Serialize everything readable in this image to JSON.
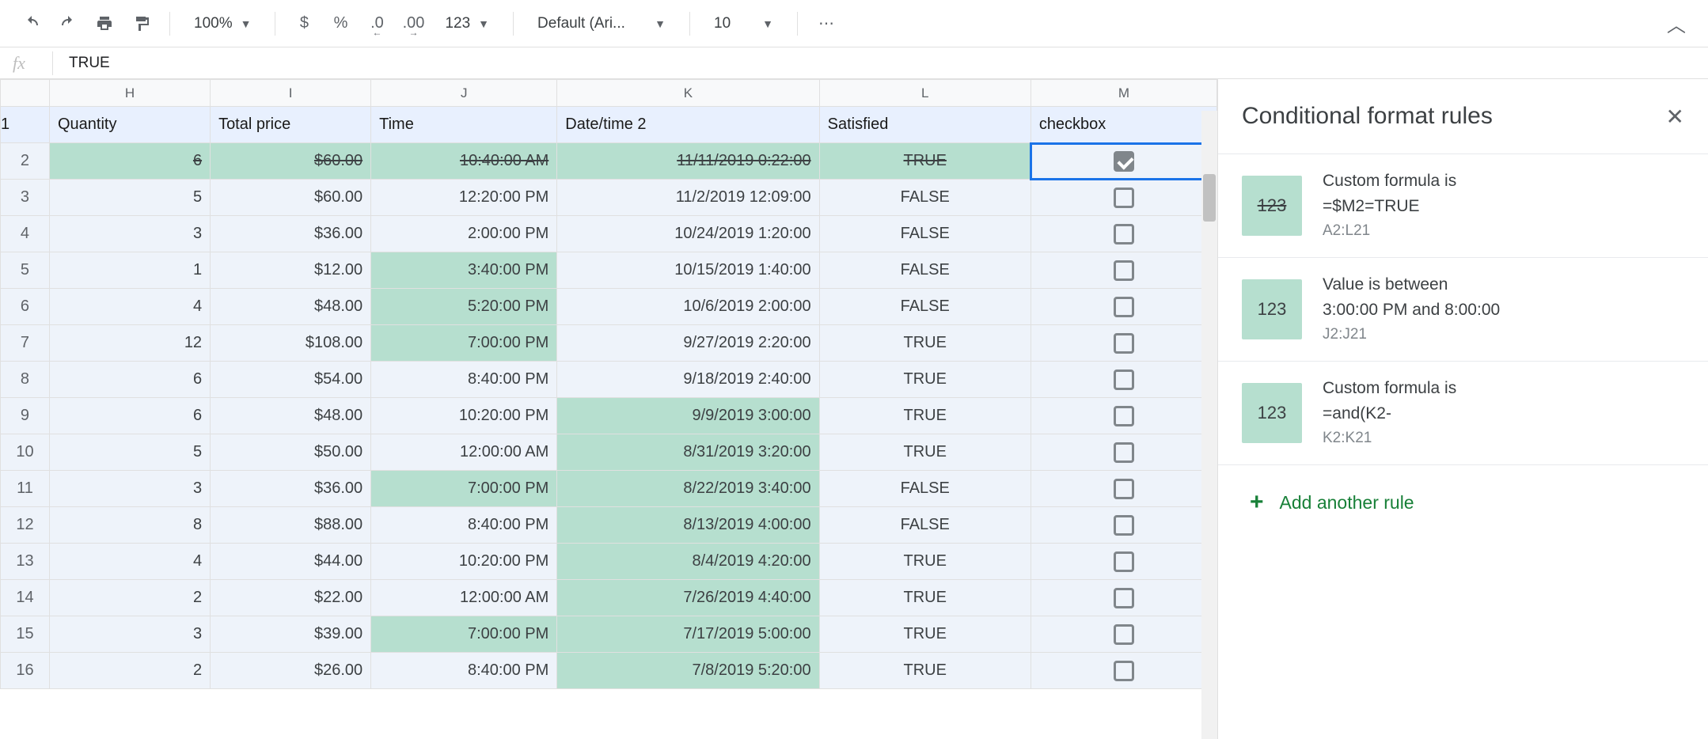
{
  "toolbar": {
    "zoom": "100%",
    "currency": "$",
    "percent": "%",
    "dec_minus": ".0",
    "dec_plus": ".00",
    "num_fmt": "123",
    "font": "Default (Ari...",
    "font_size": "10",
    "more": "⋯"
  },
  "formula_bar": {
    "fx": "fx",
    "value": "TRUE"
  },
  "columns": [
    "H",
    "I",
    "J",
    "K",
    "L",
    "M"
  ],
  "headers": {
    "H": "Quantity",
    "I": "Total price",
    "J": "Time",
    "K": "Date/time 2",
    "L": "Satisfied",
    "M": "checkbox"
  },
  "rows": [
    {
      "n": 2,
      "H": "6",
      "I": "$60.00",
      "J": "10:40:00 AM",
      "K": "11/11/2019 0:22:00",
      "L": "TRUE",
      "M": true,
      "row_hl": true,
      "strike": true
    },
    {
      "n": 3,
      "H": "5",
      "I": "$60.00",
      "J": "12:20:00 PM",
      "K": "11/2/2019 12:09:00",
      "L": "FALSE",
      "M": false
    },
    {
      "n": 4,
      "H": "3",
      "I": "$36.00",
      "J": "2:00:00 PM",
      "K": "10/24/2019 1:20:00",
      "L": "FALSE",
      "M": false
    },
    {
      "n": 5,
      "H": "1",
      "I": "$12.00",
      "J": "3:40:00 PM",
      "K": "10/15/2019 1:40:00",
      "L": "FALSE",
      "M": false,
      "J_hl": true
    },
    {
      "n": 6,
      "H": "4",
      "I": "$48.00",
      "J": "5:20:00 PM",
      "K": "10/6/2019 2:00:00",
      "L": "FALSE",
      "M": false,
      "J_hl": true
    },
    {
      "n": 7,
      "H": "12",
      "I": "$108.00",
      "J": "7:00:00 PM",
      "K": "9/27/2019 2:20:00",
      "L": "TRUE",
      "M": false,
      "J_hl": true
    },
    {
      "n": 8,
      "H": "6",
      "I": "$54.00",
      "J": "8:40:00 PM",
      "K": "9/18/2019 2:40:00",
      "L": "TRUE",
      "M": false
    },
    {
      "n": 9,
      "H": "6",
      "I": "$48.00",
      "J": "10:20:00 PM",
      "K": "9/9/2019 3:00:00",
      "L": "TRUE",
      "M": false,
      "K_hl": true
    },
    {
      "n": 10,
      "H": "5",
      "I": "$50.00",
      "J": "12:00:00 AM",
      "K": "8/31/2019 3:20:00",
      "L": "TRUE",
      "M": false,
      "K_hl": true
    },
    {
      "n": 11,
      "H": "3",
      "I": "$36.00",
      "J": "7:00:00 PM",
      "K": "8/22/2019 3:40:00",
      "L": "FALSE",
      "M": false,
      "J_hl": true,
      "K_hl": true
    },
    {
      "n": 12,
      "H": "8",
      "I": "$88.00",
      "J": "8:40:00 PM",
      "K": "8/13/2019 4:00:00",
      "L": "FALSE",
      "M": false,
      "K_hl": true
    },
    {
      "n": 13,
      "H": "4",
      "I": "$44.00",
      "J": "10:20:00 PM",
      "K": "8/4/2019 4:20:00",
      "L": "TRUE",
      "M": false,
      "K_hl": true
    },
    {
      "n": 14,
      "H": "2",
      "I": "$22.00",
      "J": "12:00:00 AM",
      "K": "7/26/2019 4:40:00",
      "L": "TRUE",
      "M": false,
      "K_hl": true
    },
    {
      "n": 15,
      "H": "3",
      "I": "$39.00",
      "J": "7:00:00 PM",
      "K": "7/17/2019 5:00:00",
      "L": "TRUE",
      "M": false,
      "J_hl": true,
      "K_hl": true
    },
    {
      "n": 16,
      "H": "2",
      "I": "$26.00",
      "J": "8:40:00 PM",
      "K": "7/8/2019 5:20:00",
      "L": "TRUE",
      "M": false,
      "K_hl": true
    }
  ],
  "panel": {
    "title": "Conditional format rules",
    "rules": [
      {
        "swatch": "123",
        "swatch_strike": true,
        "line1": "Custom formula is",
        "line2": "=$M2=TRUE",
        "range": "A2:L21"
      },
      {
        "swatch": "123",
        "line1": "Value is between",
        "line2": "3:00:00 PM and 8:00:00",
        "range": "J2:J21"
      },
      {
        "swatch": "123",
        "line1": "Custom formula is",
        "line2": "=and(K2-",
        "range": "K2:K21"
      }
    ],
    "add_label": "Add another rule"
  }
}
